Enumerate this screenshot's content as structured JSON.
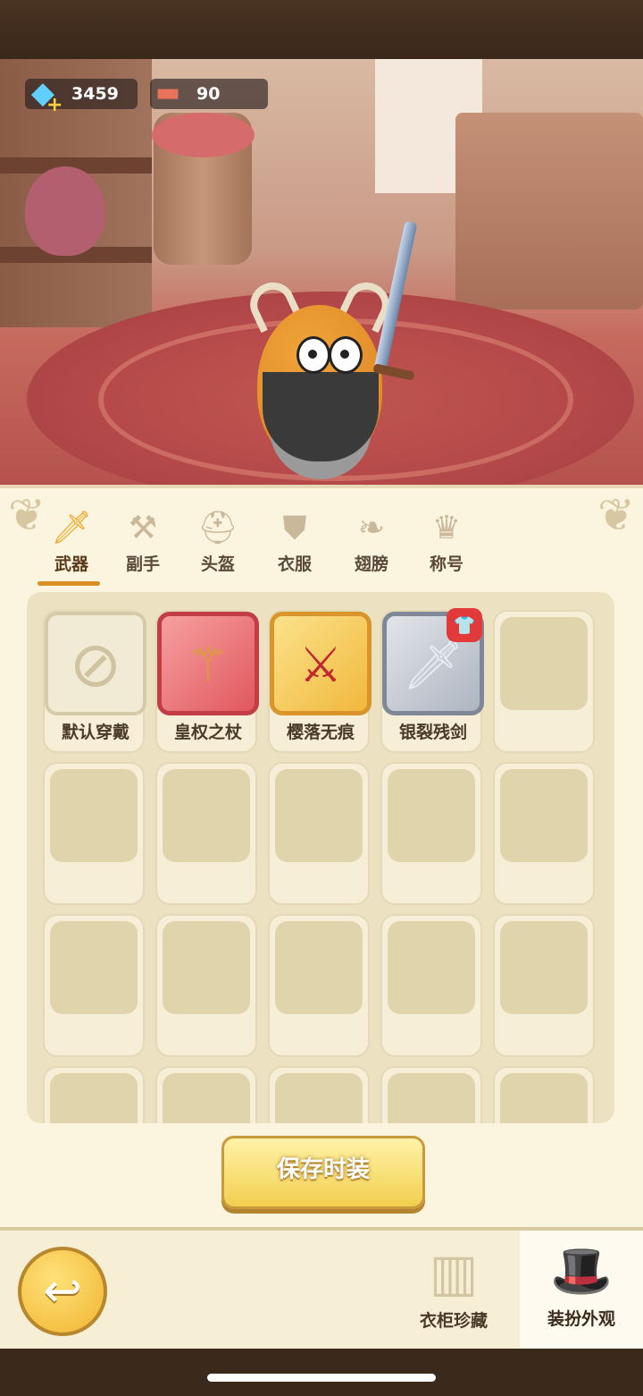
{
  "currencies": {
    "gems": {
      "value": "3459",
      "icon": "gem-plus-icon"
    },
    "meat": {
      "value": "90",
      "icon": "meat-icon"
    }
  },
  "tabs": [
    {
      "label": "武器",
      "icon": "sword-icon",
      "active": true
    },
    {
      "label": "副手",
      "icon": "offhand-icon"
    },
    {
      "label": "头盔",
      "icon": "helmet-icon"
    },
    {
      "label": "衣服",
      "icon": "armor-icon"
    },
    {
      "label": "翅膀",
      "icon": "wings-icon"
    },
    {
      "label": "称号",
      "icon": "crown-title-icon"
    }
  ],
  "items": [
    {
      "name": "默认穿戴",
      "rarity": "none",
      "icon": "no-sign-icon"
    },
    {
      "name": "皇权之杖",
      "rarity": "red",
      "icon": "scepter-icon"
    },
    {
      "name": "樱落无痕",
      "rarity": "gold",
      "icon": "katana-icon"
    },
    {
      "name": "银裂残剑",
      "rarity": "gray",
      "icon": "broken-sword-icon",
      "badge": "shirt-badge-icon"
    }
  ],
  "save_button": "保存时装",
  "bottom_nav": {
    "wardrobe": "衣柜珍藏",
    "appearance": "装扮外观"
  },
  "colors": {
    "panel_bg": "#fbf4df",
    "tab_active": "#d98f26",
    "rarity_red": "#c23d46",
    "rarity_gold": "#d9952a",
    "rarity_gray": "#7f8896"
  }
}
